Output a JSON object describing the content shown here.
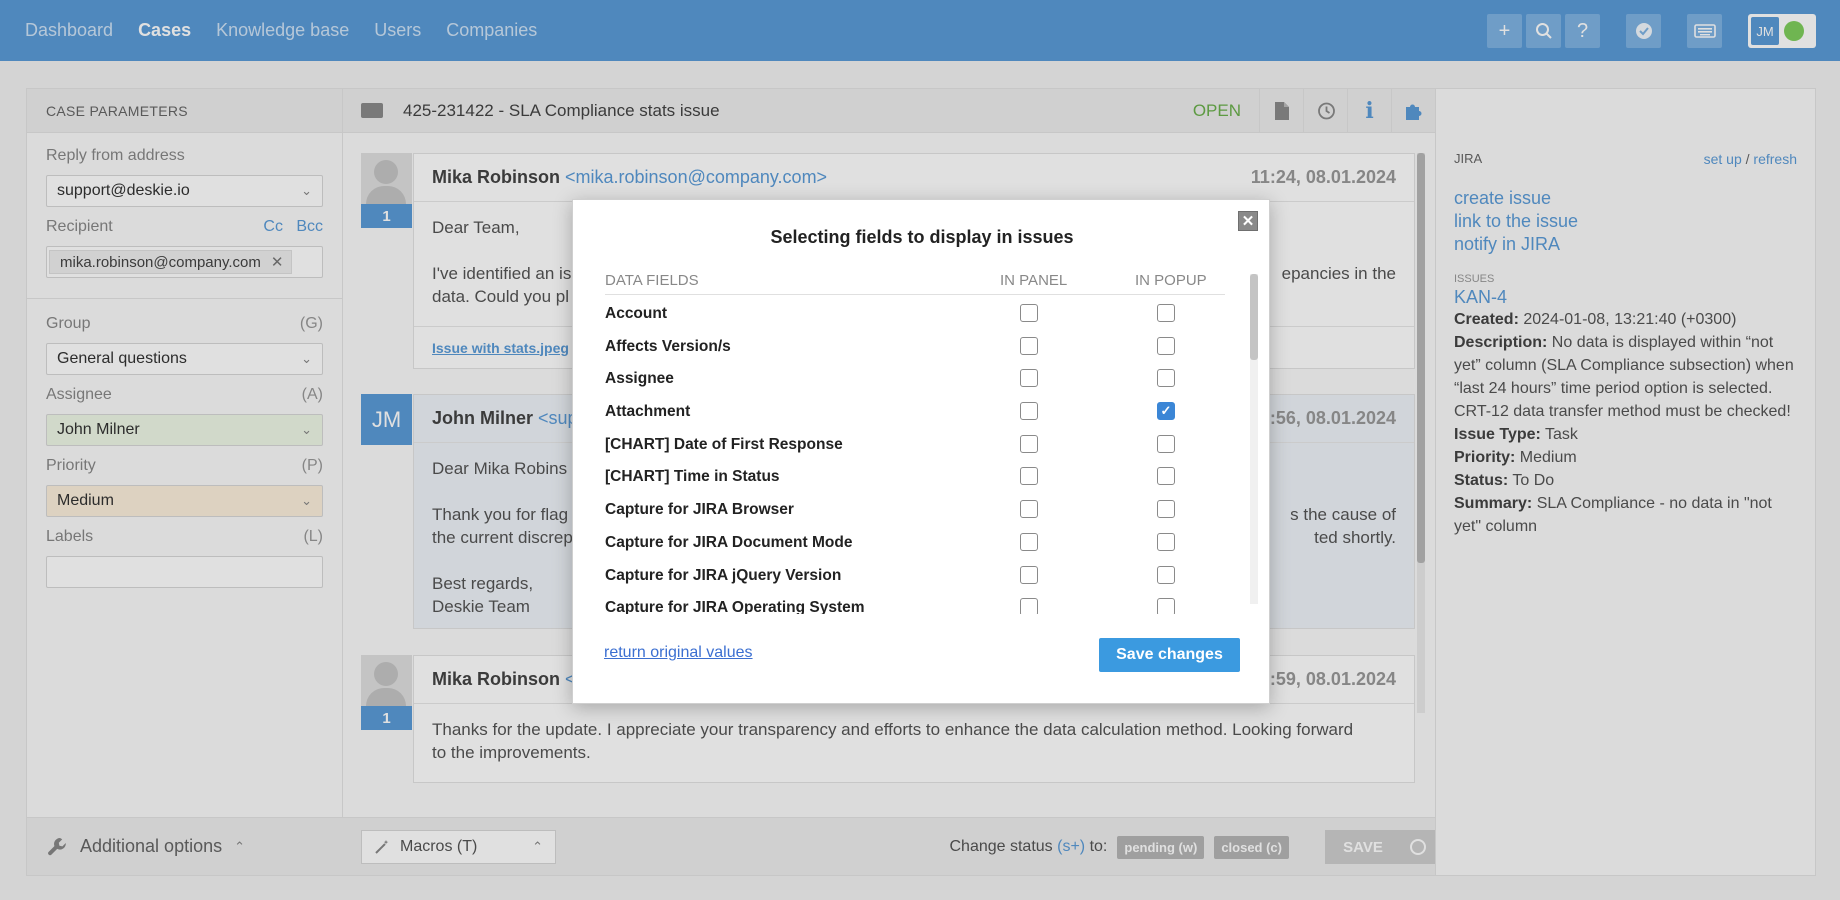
{
  "nav": {
    "items": [
      "Dashboard",
      "Cases",
      "Knowledge base",
      "Users",
      "Companies"
    ],
    "active": "Cases"
  },
  "user": {
    "initials": "JM",
    "status_color": "#7fcf5d"
  },
  "toolbar_icons": [
    "plus-icon",
    "search-icon",
    "help-icon",
    "check-badge-icon",
    "keyboard-icon"
  ],
  "case_params": {
    "title": "CASE PARAMETERS",
    "reply_from": {
      "label": "Reply from address",
      "value": "support@deskie.io"
    },
    "recipient": {
      "label": "Recipient",
      "cc": "Cc",
      "bcc": "Bcc",
      "chip": "mika.robinson@company.com"
    },
    "group": {
      "label": "Group",
      "hotkey": "(G)",
      "value": "General questions"
    },
    "assignee": {
      "label": "Assignee",
      "hotkey": "(A)",
      "value": "John Milner"
    },
    "priority": {
      "label": "Priority",
      "hotkey": "(P)",
      "value": "Medium"
    },
    "labels": {
      "label": "Labels",
      "hotkey": "(L)",
      "value": ""
    },
    "additional": "Additional options"
  },
  "case": {
    "title": "425-231422 - SLA Compliance stats issue",
    "status": "OPEN"
  },
  "messages": [
    {
      "author": "Mika Robinson",
      "email": "<mika.robinson@company.com>",
      "time": "11:24, 08.01.2024",
      "num": "1",
      "line1": "Dear Team,",
      "line2": "I've identified an is",
      "line2b": "epancies in the",
      "line3": "data. Could you pl",
      "attachment": "Issue with stats.jpeg"
    },
    {
      "author": "John Milner",
      "email": "<supp",
      "time": ":56, 08.01.2024",
      "initials": "JM",
      "line1": "Dear Mika Robins",
      "line2": "Thank you for flag",
      "line2b": "s the cause of",
      "line3": "the current discrep",
      "line3b": "ted shortly.",
      "line4": "Best regards,",
      "line5": "Deskie Team"
    },
    {
      "author": "Mika Robinson",
      "email": "<r",
      "time": ":59, 08.01.2024",
      "num": "1",
      "line1": "Thanks for the update. I appreciate your transparency and efforts to enhance the data calculation method. Looking forward",
      "line2": "to the improvements."
    }
  ],
  "footer": {
    "macros": "Macros (T)",
    "change_status": "Change status",
    "hotkey": "(s+)",
    "to": "to:",
    "pending": "pending (w)",
    "closed": "closed (c)",
    "save": "SAVE"
  },
  "jira": {
    "title": "JIRA",
    "setup": "set up",
    "sep": "/",
    "refresh": "refresh",
    "actions": [
      "create issue",
      "link to the issue",
      "notify in JIRA"
    ],
    "issues_label": "ISSUES",
    "issue_key": "KAN-4",
    "created_label": "Created:",
    "created": "2024-01-08, 13:21:40 (+0300)",
    "desc_label": "Description:",
    "desc": "No data is displayed within “not yet” column (SLA Compliance subsection) when “last 24 hours” time period option is selected. CRT-12 data transfer method must be checked!",
    "type_label": "Issue Type:",
    "type": "Task",
    "priority_label": "Priority:",
    "priority": "Medium",
    "status_label": "Status:",
    "status": "To Do",
    "summary_label": "Summary:",
    "summary": "SLA Compliance - no data in \"not yet\" column"
  },
  "modal": {
    "title": "Selecting fields to display in issues",
    "col_fields": "DATA FIELDS",
    "col_panel": "IN PANEL",
    "col_popup": "IN POPUP",
    "rows": [
      {
        "name": "Account",
        "panel": false,
        "popup": false
      },
      {
        "name": "Affects Version/s",
        "panel": false,
        "popup": false
      },
      {
        "name": "Assignee",
        "panel": false,
        "popup": false
      },
      {
        "name": "Attachment",
        "panel": false,
        "popup": true
      },
      {
        "name": "[CHART] Date of First Response",
        "panel": false,
        "popup": false
      },
      {
        "name": "[CHART] Time in Status",
        "panel": false,
        "popup": false
      },
      {
        "name": "Capture for JIRA Browser",
        "panel": false,
        "popup": false
      },
      {
        "name": "Capture for JIRA Document Mode",
        "panel": false,
        "popup": false
      },
      {
        "name": "Capture for JIRA jQuery Version",
        "panel": false,
        "popup": false
      },
      {
        "name": "Capture for JIRA Operating System",
        "panel": false,
        "popup": false
      }
    ],
    "return": "return original values",
    "save": "Save changes"
  }
}
